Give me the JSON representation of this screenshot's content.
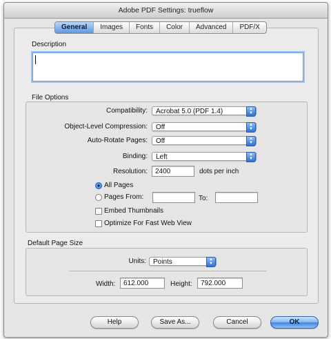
{
  "window": {
    "title": "Adobe PDF Settings: trueflow"
  },
  "tabs": [
    {
      "label": "General",
      "active": true
    },
    {
      "label": "Images"
    },
    {
      "label": "Fonts"
    },
    {
      "label": "Color"
    },
    {
      "label": "Advanced"
    },
    {
      "label": "PDF/X"
    }
  ],
  "description": {
    "label": "Description",
    "value": ""
  },
  "file_options": {
    "label": "File Options",
    "compatibility": {
      "label": "Compatibility:",
      "value": "Acrobat 5.0 (PDF 1.4)"
    },
    "compression": {
      "label": "Object-Level Compression:",
      "value": "Off"
    },
    "auto_rotate": {
      "label": "Auto-Rotate Pages:",
      "value": "Off"
    },
    "binding": {
      "label": "Binding:",
      "value": "Left"
    },
    "resolution": {
      "label": "Resolution:",
      "value": "2400",
      "unit": "dots per inch"
    },
    "all_pages": {
      "label": "All Pages",
      "selected": true
    },
    "pages_from": {
      "label": "Pages From:",
      "value": "",
      "to_label": "To:",
      "to_value": ""
    },
    "embed_thumbnails": {
      "label": "Embed Thumbnails",
      "checked": false
    },
    "optimize_web": {
      "label": "Optimize For Fast Web View",
      "checked": false
    }
  },
  "page_size": {
    "label": "Default Page Size",
    "units": {
      "label": "Units:",
      "value": "Points"
    },
    "width": {
      "label": "Width:",
      "value": "612.000"
    },
    "height": {
      "label": "Height:",
      "value": "792.000"
    }
  },
  "buttons": {
    "help": "Help",
    "save_as": "Save As...",
    "cancel": "Cancel",
    "ok": "OK"
  },
  "colors": {
    "accent": "#3d86e3",
    "focus_ring": "#9cc3ef"
  }
}
